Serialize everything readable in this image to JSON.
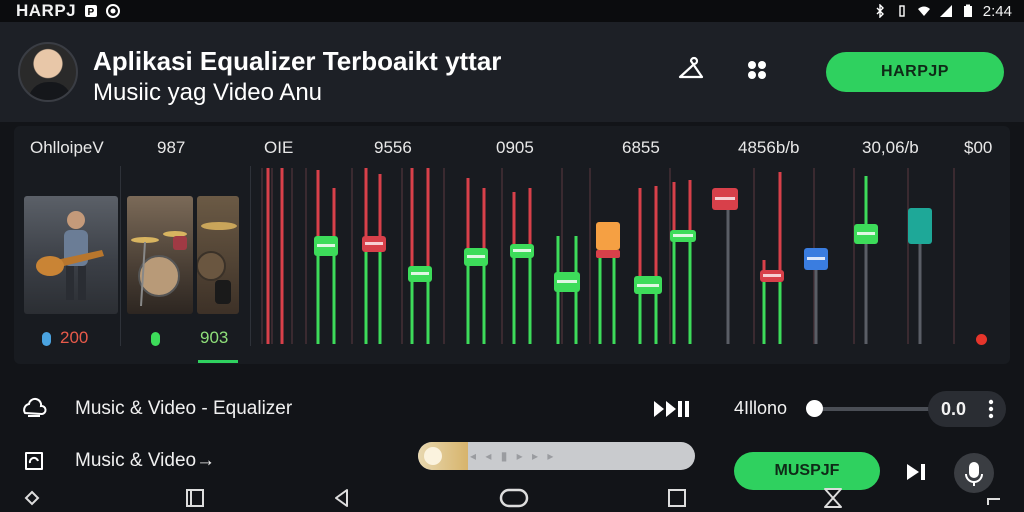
{
  "status_bar": {
    "app_name": "HARPJ",
    "time": "2:44",
    "icons": [
      "app-p-icon",
      "record-icon",
      "bluetooth-icon",
      "vibrate-icon",
      "wifi-icon",
      "signal-icon",
      "battery-icon"
    ]
  },
  "header": {
    "title": "Aplikasi Equalizer Terboaikt yttar",
    "subtitle": "Musiic yag Video Anu",
    "action_button": "HARPJP",
    "icons": [
      "hanger-icon",
      "grid-dots-icon"
    ]
  },
  "equalizer": {
    "labels": [
      "OhlloipeV",
      "987",
      "OIE",
      "9556",
      "0905",
      "6855",
      "4856b/b",
      "30,06/b",
      "$00"
    ],
    "footer": {
      "value1": "200",
      "value2": "903"
    },
    "accent_colors": {
      "green": "#3ddc5a",
      "red": "#d8404a",
      "orange": "#f5a043",
      "blue": "#3a7de0",
      "teal": "#1ea898"
    }
  },
  "rows": [
    {
      "label": "Music & Video - Equalizer",
      "volume_label": "4Illono",
      "volume_value": "0.0",
      "volume_level": 0.02
    },
    {
      "label": "Music & Video→",
      "seek_progress": 0.18,
      "button": "MUSPJF"
    }
  ],
  "navbar": {
    "icons": [
      "nav-diamond-icon",
      "nav-recent-icon",
      "nav-back-icon",
      "nav-home-icon",
      "nav-square-icon",
      "nav-hourglass-icon",
      "nav-corner-icon"
    ]
  }
}
